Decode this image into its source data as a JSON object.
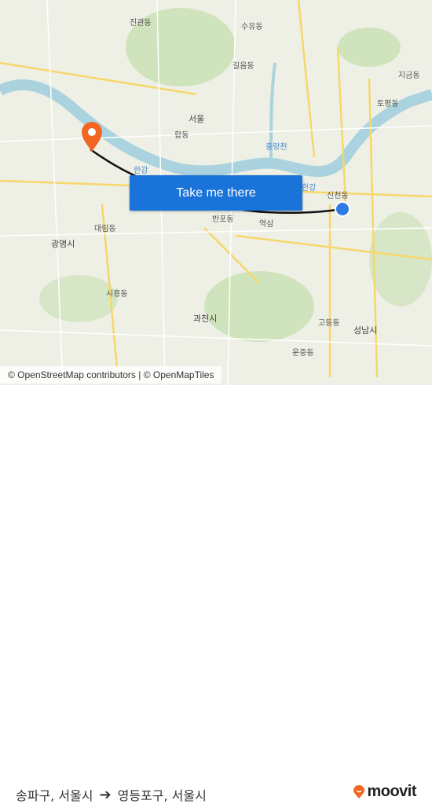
{
  "map": {
    "labels": {
      "hangang": "한강",
      "hangang2": "한강",
      "seoul": "서울",
      "jungnangcheon": "중랑천",
      "gwangmyeong": "광명시",
      "gwacheon": "과천시",
      "seongnam": "성남시",
      "sincheon": "신천동",
      "banpo": "반포동",
      "yeoksam": "역삼",
      "daerim": "대림동",
      "hapjeong": "합동",
      "siheung": "시흥동",
      "godeung": "고등동",
      "unjung": "운중동",
      "jingwan": "진관동",
      "suyu": "수유동",
      "gireum": "길음동",
      "topyeong": "토평동",
      "jigeum": "지금동"
    },
    "colors": {
      "water": "#aad3df",
      "route": "#111111",
      "origin_marker": "#f26522",
      "destination_marker": "#2f7ae5"
    }
  },
  "cta_label": "Take me there",
  "attribution": "© OpenStreetMap contributors | © OpenMapTiles",
  "footer": {
    "origin": "송파구, 서울시",
    "arrow_icon": "arrow-right-icon",
    "destination": "영등포구, 서울시",
    "logo": "moovit"
  }
}
